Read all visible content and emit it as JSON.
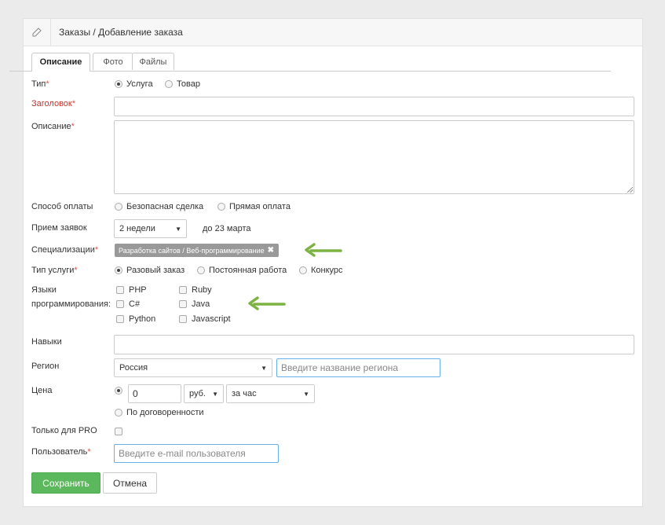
{
  "header": {
    "title": "Заказы / Добавление заказа",
    "icon": "edit-icon"
  },
  "tabs": [
    "Описание",
    "Фото",
    "Файлы"
  ],
  "form": {
    "type": {
      "label": "Тип",
      "options": [
        "Услуга",
        "Товар"
      ],
      "selected": "Услуга"
    },
    "title": {
      "label": "Заголовок",
      "value": ""
    },
    "description": {
      "label": "Описание",
      "value": ""
    },
    "payment": {
      "label": "Способ оплаты",
      "options": [
        "Безопасная сделка",
        "Прямая оплата"
      ]
    },
    "acceptance": {
      "label": "Прием заявок",
      "value": "2 недели",
      "note": "до 23 марта"
    },
    "specializations": {
      "label": "Специализации",
      "tag": "Разработка сайтов / Веб-программирование"
    },
    "service_type": {
      "label": "Тип услуги",
      "options": [
        "Разовый заказ",
        "Постоянная работа",
        "Конкурс"
      ],
      "selected": "Разовый заказ"
    },
    "languages": {
      "label_line1": "Языки",
      "label_line2": "программирования:",
      "options": [
        "PHP",
        "Ruby",
        "C#",
        "Java",
        "Python",
        "Javascript"
      ]
    },
    "skills": {
      "label": "Навыки",
      "value": ""
    },
    "region": {
      "label": "Регион",
      "country": "Россия",
      "placeholder": "Введите название региона"
    },
    "price": {
      "label": "Цена",
      "value": "0",
      "currency": "руб.",
      "period": "за час",
      "negotiable": "По договоренности"
    },
    "pro_only": {
      "label": "Только для PRO"
    },
    "user": {
      "label": "Пользователь",
      "placeholder": "Введите e-mail пользователя"
    }
  },
  "required_mark": "*",
  "buttons": {
    "save": "Сохранить",
    "cancel": "Отмена"
  },
  "colors": {
    "save": "#5cb85c",
    "required": "#d9534f",
    "arrow": "#7cb342",
    "tag": "#999999"
  }
}
